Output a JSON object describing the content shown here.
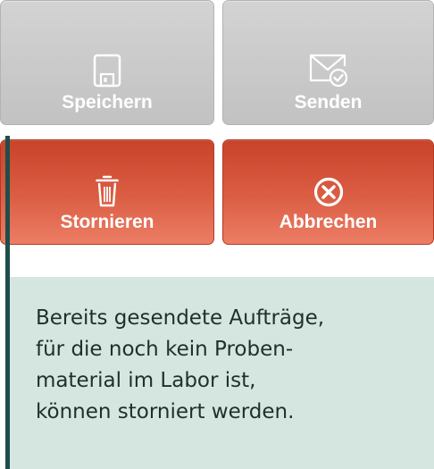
{
  "buttons": {
    "save_label": "Speichern",
    "send_label": "Senden",
    "cancel_label": "Stornieren",
    "abort_label": "Abbrechen"
  },
  "icons": {
    "save": "floppy-disk-icon",
    "send": "envelope-check-icon",
    "cancel": "trash-icon",
    "abort": "circle-x-icon"
  },
  "colors": {
    "gray_button": "#c8c8c8",
    "red_button": "#db5e44",
    "note_background": "#d5e6e1",
    "accent_bar": "#1c4e4c"
  },
  "note": {
    "text": "Bereits gesendete Aufträge,\nfür die noch kein Proben-\nmaterial im Labor ist,\nkönnen storniert werden."
  }
}
